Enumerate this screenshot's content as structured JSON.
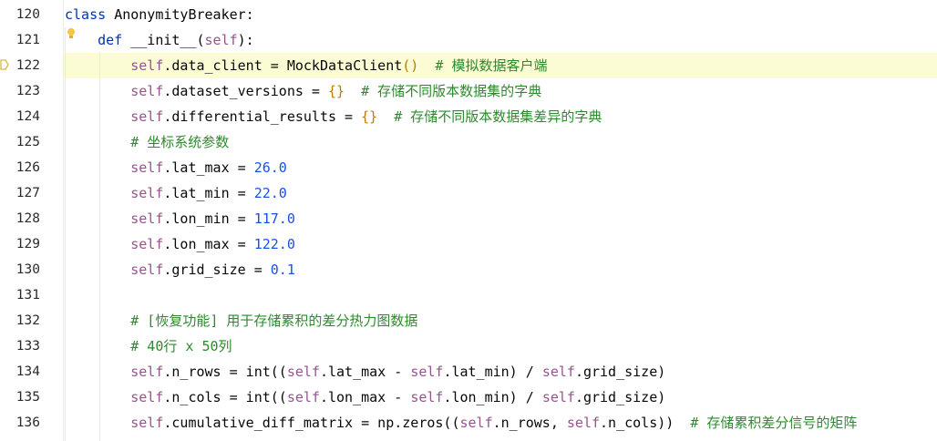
{
  "editor": {
    "lines": [
      {
        "num": "120",
        "tokens": [
          {
            "t": "class ",
            "c": "kw"
          },
          {
            "t": "AnonymityBreaker:",
            "c": "fn"
          }
        ]
      },
      {
        "num": "121",
        "tokens": [
          {
            "t": "    "
          },
          {
            "t": "def ",
            "c": "kw"
          },
          {
            "t": "__init__",
            "c": "fn"
          },
          {
            "t": "(",
            "c": "paren"
          },
          {
            "t": "self",
            "c": "self"
          },
          {
            "t": "):",
            "c": "paren"
          }
        ]
      },
      {
        "num": "122",
        "current": true,
        "tokens": [
          {
            "t": "        "
          },
          {
            "t": "self",
            "c": "self"
          },
          {
            "t": ".data_client = MockDataClient"
          },
          {
            "t": "()",
            "c": "par-hl"
          },
          {
            "t": "  "
          },
          {
            "t": "# 模拟数据客户端",
            "c": "com"
          }
        ]
      },
      {
        "num": "123",
        "tokens": [
          {
            "t": "        "
          },
          {
            "t": "self",
            "c": "self"
          },
          {
            "t": ".dataset_versions = "
          },
          {
            "t": "{}",
            "c": "par-hl"
          },
          {
            "t": "  "
          },
          {
            "t": "# 存储不同版本数据集的字典",
            "c": "com"
          }
        ]
      },
      {
        "num": "124",
        "tokens": [
          {
            "t": "        "
          },
          {
            "t": "self",
            "c": "self"
          },
          {
            "t": ".differential_results = "
          },
          {
            "t": "{}",
            "c": "par-hl"
          },
          {
            "t": "  "
          },
          {
            "t": "# 存储不同版本数据集差异的字典",
            "c": "com"
          }
        ]
      },
      {
        "num": "125",
        "tokens": [
          {
            "t": "        "
          },
          {
            "t": "# 坐标系统参数",
            "c": "com"
          }
        ]
      },
      {
        "num": "126",
        "tokens": [
          {
            "t": "        "
          },
          {
            "t": "self",
            "c": "self"
          },
          {
            "t": ".lat_max = "
          },
          {
            "t": "26.0",
            "c": "num"
          }
        ]
      },
      {
        "num": "127",
        "tokens": [
          {
            "t": "        "
          },
          {
            "t": "self",
            "c": "self"
          },
          {
            "t": ".lat_min = "
          },
          {
            "t": "22.0",
            "c": "num"
          }
        ]
      },
      {
        "num": "128",
        "tokens": [
          {
            "t": "        "
          },
          {
            "t": "self",
            "c": "self"
          },
          {
            "t": ".lon_min = "
          },
          {
            "t": "117.0",
            "c": "num"
          }
        ]
      },
      {
        "num": "129",
        "tokens": [
          {
            "t": "        "
          },
          {
            "t": "self",
            "c": "self"
          },
          {
            "t": ".lon_max = "
          },
          {
            "t": "122.0",
            "c": "num"
          }
        ]
      },
      {
        "num": "130",
        "tokens": [
          {
            "t": "        "
          },
          {
            "t": "self",
            "c": "self"
          },
          {
            "t": ".grid_size = "
          },
          {
            "t": "0.1",
            "c": "num"
          }
        ]
      },
      {
        "num": "131",
        "tokens": []
      },
      {
        "num": "132",
        "tokens": [
          {
            "t": "        "
          },
          {
            "t": "# [恢复功能] 用于存储累积的差分热力图数据",
            "c": "com"
          }
        ]
      },
      {
        "num": "133",
        "tokens": [
          {
            "t": "        "
          },
          {
            "t": "# 40行 x 50列",
            "c": "com"
          }
        ]
      },
      {
        "num": "134",
        "tokens": [
          {
            "t": "        "
          },
          {
            "t": "self",
            "c": "self"
          },
          {
            "t": ".n_rows = int(("
          },
          {
            "t": "self",
            "c": "self"
          },
          {
            "t": ".lat_max - "
          },
          {
            "t": "self",
            "c": "self"
          },
          {
            "t": ".lat_min) / "
          },
          {
            "t": "self",
            "c": "self"
          },
          {
            "t": ".grid_size)"
          }
        ]
      },
      {
        "num": "135",
        "tokens": [
          {
            "t": "        "
          },
          {
            "t": "self",
            "c": "self"
          },
          {
            "t": ".n_cols = int(("
          },
          {
            "t": "self",
            "c": "self"
          },
          {
            "t": ".lon_max - "
          },
          {
            "t": "self",
            "c": "self"
          },
          {
            "t": ".lon_min) / "
          },
          {
            "t": "self",
            "c": "self"
          },
          {
            "t": ".grid_size)"
          }
        ]
      },
      {
        "num": "136",
        "tokens": [
          {
            "t": "        "
          },
          {
            "t": "self",
            "c": "self"
          },
          {
            "t": ".cumulative_diff_matrix = np.zeros(("
          },
          {
            "t": "self",
            "c": "self"
          },
          {
            "t": ".n_rows, "
          },
          {
            "t": "self",
            "c": "self"
          },
          {
            "t": ".n_cols))  "
          },
          {
            "t": "# 存储累积差分信号的矩阵",
            "c": "com"
          }
        ]
      }
    ],
    "colors": {
      "keyword": "#0033b3",
      "self": "#94558d",
      "number": "#1750eb",
      "comment": "#2d8a2d",
      "current_line": "#fcfcd4"
    },
    "icons": [
      "intention-bulb-icon",
      "breakpoint-marker-icon"
    ]
  }
}
